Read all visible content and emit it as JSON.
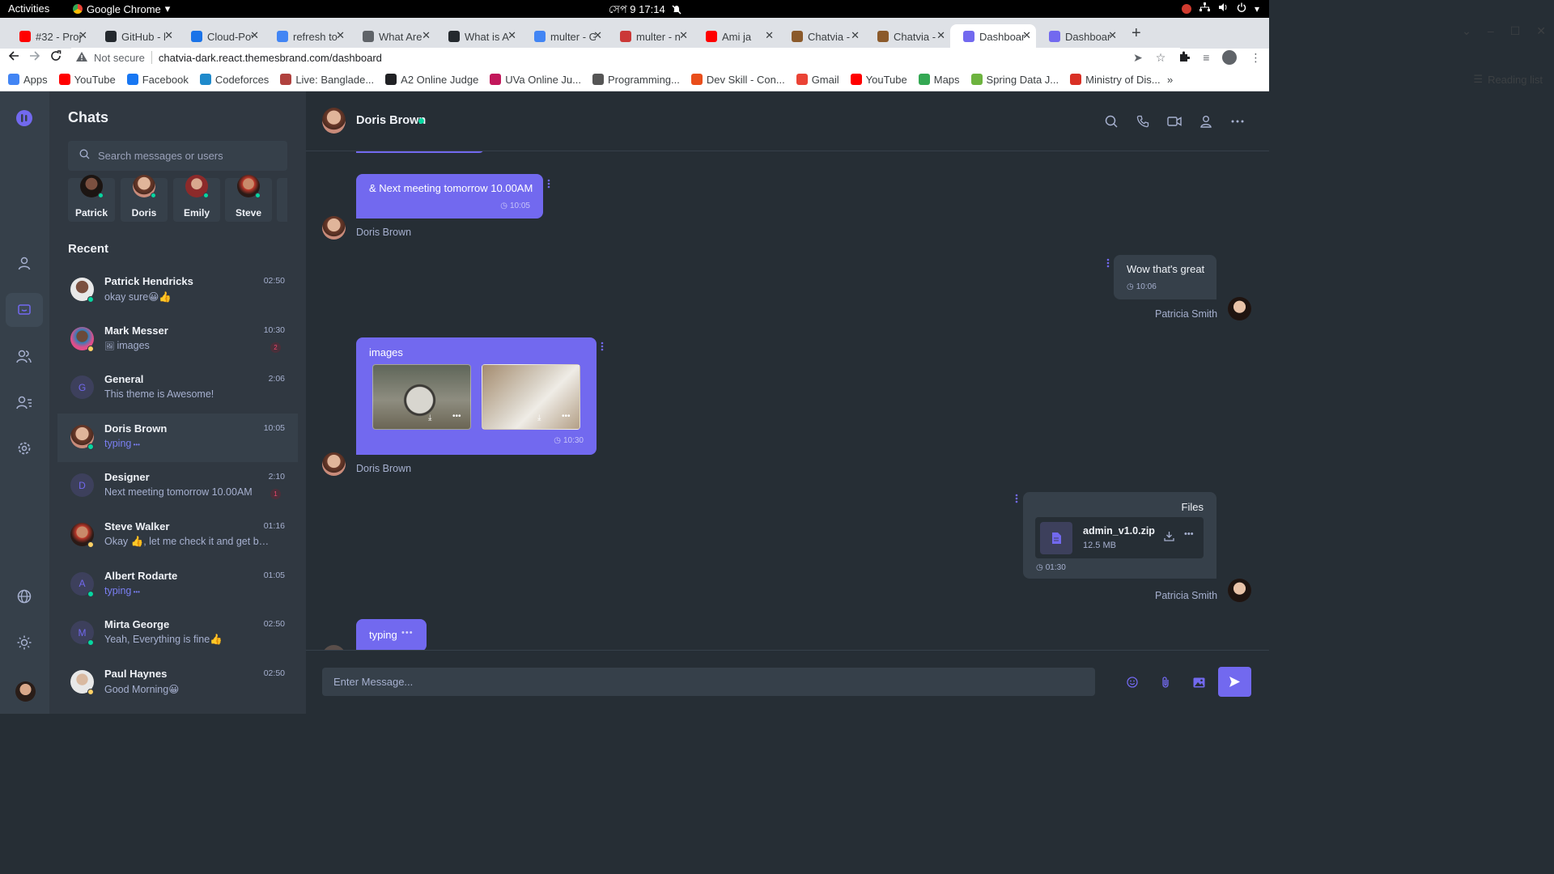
{
  "system": {
    "activities": "Activities",
    "app_name": "Google Chrome",
    "clock": "সেপ 9  17:14"
  },
  "tabs": [
    {
      "title": "#32 - Proj",
      "color": "#ff0000"
    },
    {
      "title": "GitHub - l",
      "color": "#24292e"
    },
    {
      "title": "Cloud-Pov",
      "color": "#1a73e8"
    },
    {
      "title": "refresh to",
      "color": "#4285f4"
    },
    {
      "title": "What Are",
      "color": "#5f6368"
    },
    {
      "title": "What is A",
      "color": "#24292e"
    },
    {
      "title": "multer - G",
      "color": "#4285f4"
    },
    {
      "title": "multer - n",
      "color": "#cb3837"
    },
    {
      "title": "Ami ja",
      "color": "#ff0000"
    },
    {
      "title": "Chatvia - I",
      "color": "#8b5a2b"
    },
    {
      "title": "Chatvia - I",
      "color": "#8b5a2b"
    },
    {
      "title": "Dashboar",
      "color": "#7269ef"
    },
    {
      "title": "Dashboar",
      "color": "#7269ef"
    }
  ],
  "address": {
    "security": "Not secure",
    "url": "chatvia-dark.react.themesbrand.com/dashboard"
  },
  "bookmarks": [
    {
      "label": "Apps",
      "color": "#4285f4"
    },
    {
      "label": "YouTube",
      "color": "#ff0000"
    },
    {
      "label": "Facebook",
      "color": "#1877f2"
    },
    {
      "label": "Codeforces",
      "color": "#1f8acb"
    },
    {
      "label": "Live: Banglade...",
      "color": "#b0413e"
    },
    {
      "label": "A2 Online Judge",
      "color": "#202124"
    },
    {
      "label": "UVa Online Ju...",
      "color": "#c2185b"
    },
    {
      "label": "Programming...",
      "color": "#555555"
    },
    {
      "label": "Dev Skill - Con...",
      "color": "#e94e1b"
    },
    {
      "label": "Gmail",
      "color": "#ea4335"
    },
    {
      "label": "YouTube",
      "color": "#ff0000"
    },
    {
      "label": "Maps",
      "color": "#34a853"
    },
    {
      "label": "Spring Data J...",
      "color": "#6db33f"
    },
    {
      "label": "Ministry of Dis...",
      "color": "#d93025"
    }
  ],
  "reading_list": "Reading list",
  "chatlist": {
    "title": "Chats",
    "search_placeholder": "Search messages or users",
    "online_users": [
      {
        "name": "Patrick"
      },
      {
        "name": "Doris"
      },
      {
        "name": "Emily"
      },
      {
        "name": "Steve"
      }
    ],
    "recent_title": "Recent",
    "conversations": [
      {
        "name": "Patrick Hendricks",
        "message": "okay sure😀👍",
        "time": "02:50",
        "status": "online"
      },
      {
        "name": "Mark Messer",
        "message": "images",
        "time": "10:30",
        "badge": "2",
        "status": "away"
      },
      {
        "name": "General",
        "message": "This theme is Awesome!",
        "time": "2:06",
        "initial": "G"
      },
      {
        "name": "Doris Brown",
        "message": "typing",
        "time": "10:05",
        "status": "online",
        "typing": true
      },
      {
        "name": "Designer",
        "message": "Next meeting tomorrow 10.00AM",
        "time": "2:10",
        "badge": "1",
        "initial": "D"
      },
      {
        "name": "Steve Walker",
        "message": "Okay 👍, let me check it and get bac...",
        "time": "01:16",
        "status": "away"
      },
      {
        "name": "Albert Rodarte",
        "message": "typing",
        "time": "01:05",
        "status": "online",
        "typing": true,
        "initial": "A"
      },
      {
        "name": "Mirta George",
        "message": "Yeah, Everything is fine👍",
        "time": "02:50",
        "status": "online",
        "initial": "M"
      },
      {
        "name": "Paul Haynes",
        "message": "Good Morning😀",
        "time": "02:50",
        "status": "away"
      }
    ]
  },
  "conversation": {
    "contact": "Doris Brown",
    "messages": {
      "m1": {
        "text": "& Next meeting tomorrow 10.00AM",
        "time": "10:05",
        "sender": "Doris Brown"
      },
      "m2": {
        "text": "Wow that's great",
        "time": "10:06",
        "sender": "Patricia Smith"
      },
      "m3": {
        "text": "images",
        "time": "10:30",
        "sender": "Doris Brown"
      },
      "m4": {
        "title": "Files",
        "file_name": "admin_v1.0.zip",
        "file_size": "12.5 MB",
        "time": "01:30",
        "sender": "Patricia Smith"
      },
      "m5": {
        "text": "typing"
      }
    },
    "input_placeholder": "Enter Message..."
  },
  "colors": {
    "primary": "#7269ef",
    "online": "#06d6a0",
    "away": "#ffd166",
    "danger": "#ef476f"
  }
}
